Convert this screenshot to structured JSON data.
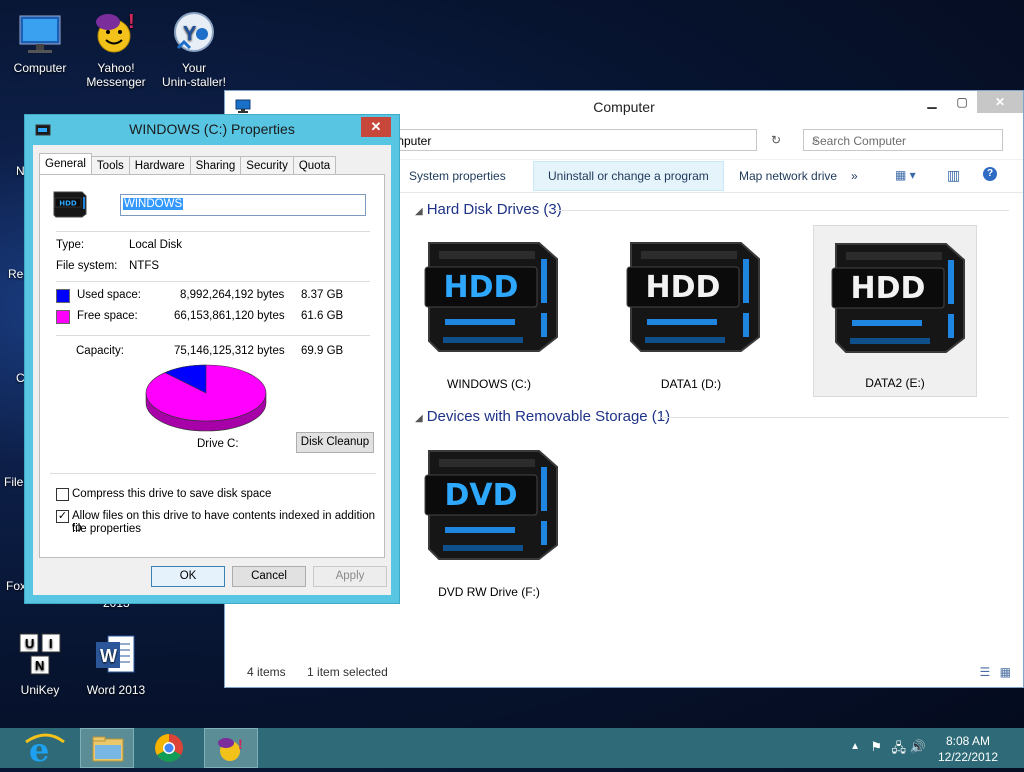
{
  "desktop": {
    "icons": [
      {
        "label_line1": "Computer",
        "label_line2": ""
      },
      {
        "label_line1": "Yahoo!",
        "label_line2": "Messenger"
      },
      {
        "label_line1": "Your",
        "label_line2": "Unin-staller!"
      },
      {
        "label_line1": "UniKey",
        "label_line2": ""
      },
      {
        "label_line1": "Word 2013",
        "label_line2": ""
      }
    ],
    "partial_labels": [
      "N",
      "Rec",
      "C",
      "File",
      "Fox",
      "2013"
    ]
  },
  "explorer": {
    "title": "Computer",
    "address": "mputer",
    "search_placeholder": "Search Computer",
    "commands": [
      "System properties",
      "Uninstall or change a program",
      "Map network drive",
      "»"
    ],
    "groups": [
      {
        "title": "Hard Disk Drives (3)"
      },
      {
        "title": "Devices with Removable Storage (1)"
      }
    ],
    "drives": [
      {
        "label": "WINDOWS (C:)",
        "badge": "HDD"
      },
      {
        "label": "DATA1 (D:)",
        "badge": "HDD"
      },
      {
        "label": "DATA2 (E:)",
        "badge": "HDD"
      },
      {
        "label": "DVD RW Drive (F:)",
        "badge": "DVD"
      }
    ],
    "status": {
      "items": "4 items",
      "selected": "1 item selected"
    }
  },
  "properties": {
    "title": "WINDOWS (C:) Properties",
    "tabs": [
      "General",
      "Tools",
      "Hardware",
      "Sharing",
      "Security",
      "Quota"
    ],
    "active_tab": "General",
    "drive_name": "WINDOWS",
    "type_label": "Type:",
    "type_value": "Local Disk",
    "fs_label": "File system:",
    "fs_value": "NTFS",
    "used_label": "Used space:",
    "used_bytes": "8,992,264,192 bytes",
    "used_size": "8.37 GB",
    "free_label": "Free space:",
    "free_bytes": "66,153,861,120 bytes",
    "free_size": "61.6 GB",
    "capacity_label": "Capacity:",
    "capacity_bytes": "75,146,125,312 bytes",
    "capacity_size": "69.9 GB",
    "used_fraction": 0.12,
    "drive_caption": "Drive C:",
    "disk_cleanup": "Disk Cleanup",
    "compress_label": "Compress this drive to save disk space",
    "compress_checked": false,
    "index_label_line1": "Allow files on this drive to have contents indexed in addition to",
    "index_label_line2": "file properties",
    "index_checked": true,
    "buttons": {
      "ok": "OK",
      "cancel": "Cancel",
      "apply": "Apply"
    },
    "colors": {
      "used": "#0000ff",
      "free": "#ff00ff"
    }
  },
  "taskbar": {
    "time": "8:08 AM",
    "date": "12/22/2012"
  }
}
